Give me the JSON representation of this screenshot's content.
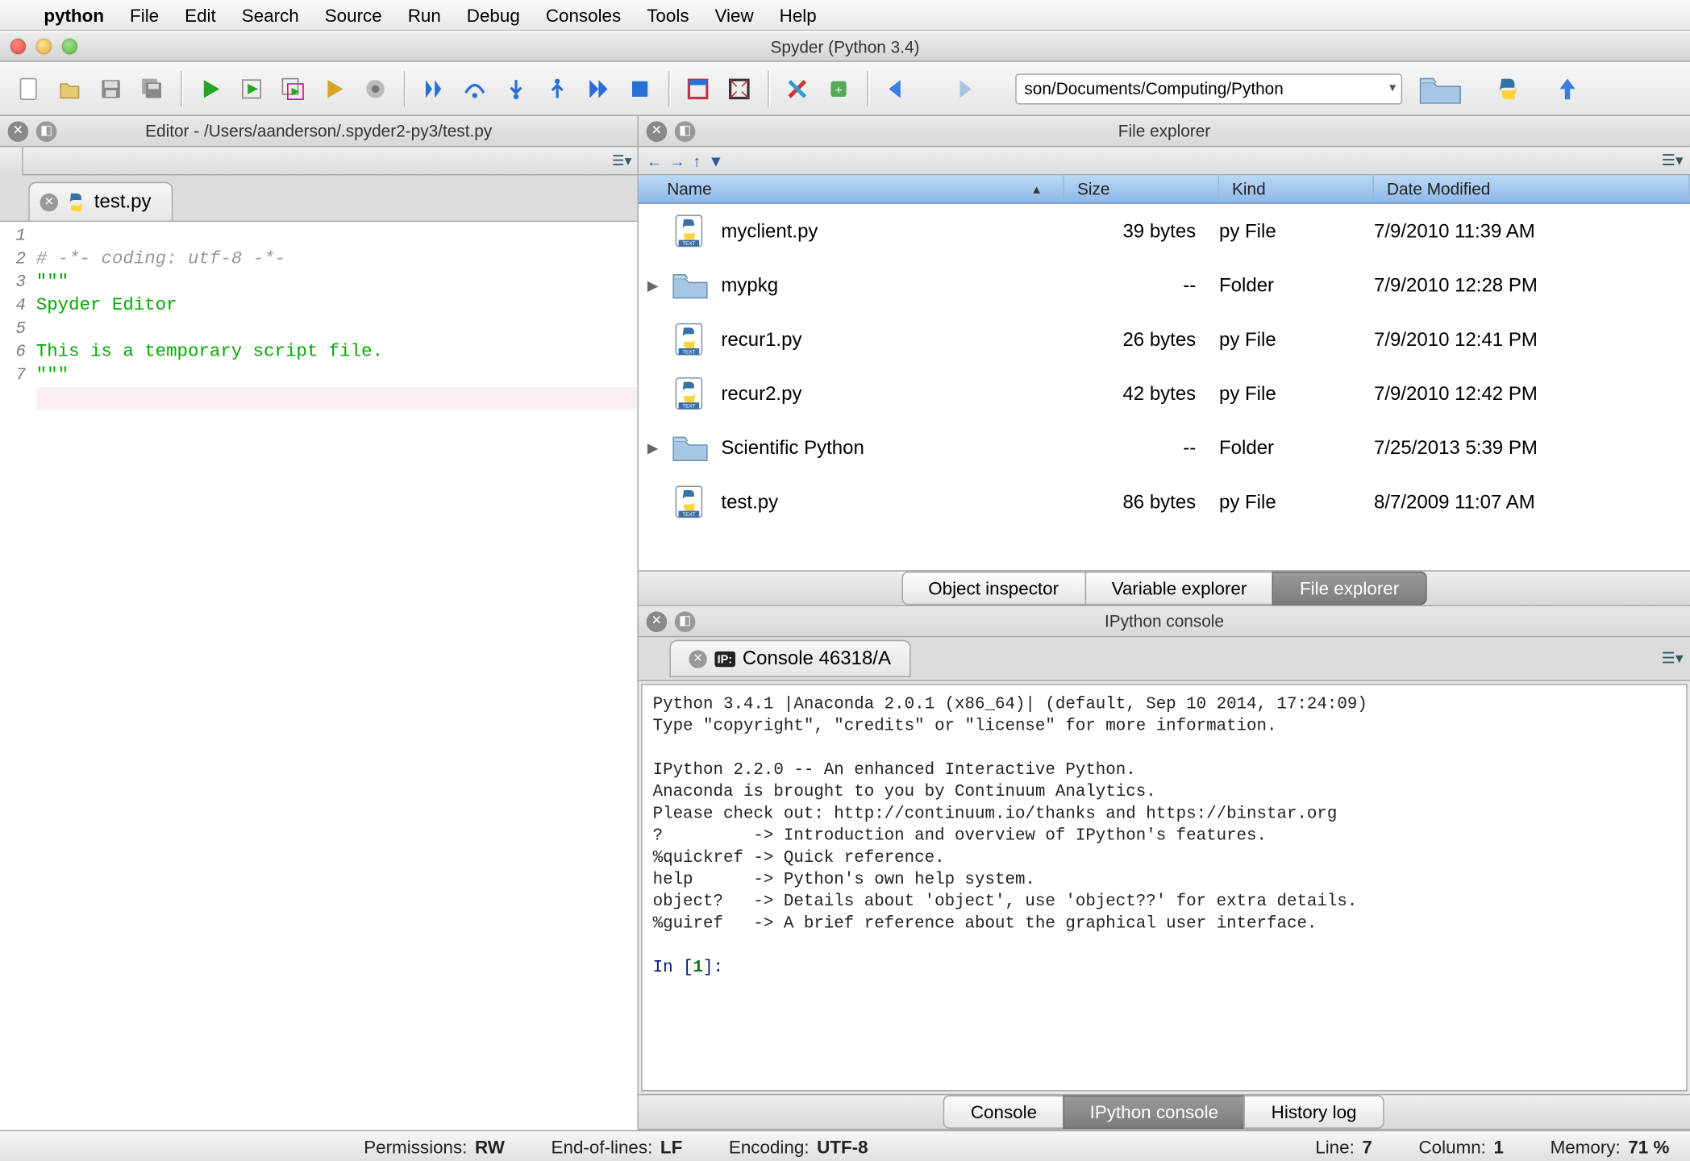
{
  "mac_menu": {
    "app": "python",
    "items": [
      "File",
      "Edit",
      "Search",
      "Source",
      "Run",
      "Debug",
      "Consoles",
      "Tools",
      "View",
      "Help"
    ]
  },
  "window": {
    "title": "Spyder (Python 3.4)"
  },
  "toolbar": {
    "working_dir": "son/Documents/Computing/Python"
  },
  "editor_pane": {
    "title": "Editor - /Users/aanderson/.spyder2-py3/test.py",
    "tab": "test.py",
    "code": {
      "line1": "# -*- coding: utf-8 -*-",
      "line2": "\"\"\"",
      "line3": "Spyder Editor",
      "line5": "This is a temporary script file.",
      "line6": "\"\"\""
    },
    "lineno": [
      "1",
      "2",
      "3",
      "4",
      "5",
      "6",
      "7"
    ]
  },
  "file_explorer": {
    "title": "File explorer",
    "cols": {
      "name": "Name",
      "size": "Size",
      "kind": "Kind",
      "date": "Date Modified"
    },
    "rows": [
      {
        "name": "myclient.py",
        "kind": "py File",
        "size": "39 bytes",
        "date": "7/9/2010 11:39 AM",
        "folder": false
      },
      {
        "name": "mypkg",
        "kind": "Folder",
        "size": "--",
        "date": "7/9/2010 12:28 PM",
        "folder": true
      },
      {
        "name": "recur1.py",
        "kind": "py File",
        "size": "26 bytes",
        "date": "7/9/2010 12:41 PM",
        "folder": false
      },
      {
        "name": "recur2.py",
        "kind": "py File",
        "size": "42 bytes",
        "date": "7/9/2010 12:42 PM",
        "folder": false
      },
      {
        "name": "Scientific Python",
        "kind": "Folder",
        "size": "--",
        "date": "7/25/2013 5:39 PM",
        "folder": true
      },
      {
        "name": "test.py",
        "kind": "py File",
        "size": "86 bytes",
        "date": "8/7/2009 11:07 AM",
        "folder": false
      }
    ],
    "bottom_tabs": [
      "Object inspector",
      "Variable explorer",
      "File explorer"
    ],
    "active_bottom_tab": 2
  },
  "ipython": {
    "title": "IPython console",
    "tab": "Console 46318/A",
    "banner": "Python 3.4.1 |Anaconda 2.0.1 (x86_64)| (default, Sep 10 2014, 17:24:09)\nType \"copyright\", \"credits\" or \"license\" for more information.\n\nIPython 2.2.0 -- An enhanced Interactive Python.\nAnaconda is brought to you by Continuum Analytics.\nPlease check out: http://continuum.io/thanks and https://binstar.org\n?         -> Introduction and overview of IPython's features.\n%quickref -> Quick reference.\nhelp      -> Python's own help system.\nobject?   -> Details about 'object', use 'object??' for extra details.\n%guiref   -> A brief reference about the graphical user interface.",
    "prompt_in": "In [",
    "prompt_num": "1",
    "prompt_close": "]:",
    "bottom_tabs": [
      "Console",
      "IPython console",
      "History log"
    ],
    "active_bottom_tab": 1
  },
  "status": {
    "permissions_label": "Permissions:",
    "permissions": "RW",
    "eol_label": "End-of-lines:",
    "eol": "LF",
    "encoding_label": "Encoding:",
    "encoding": "UTF-8",
    "line_label": "Line:",
    "line": "7",
    "column_label": "Column:",
    "column": "1",
    "memory_label": "Memory:",
    "memory": "71 %"
  }
}
